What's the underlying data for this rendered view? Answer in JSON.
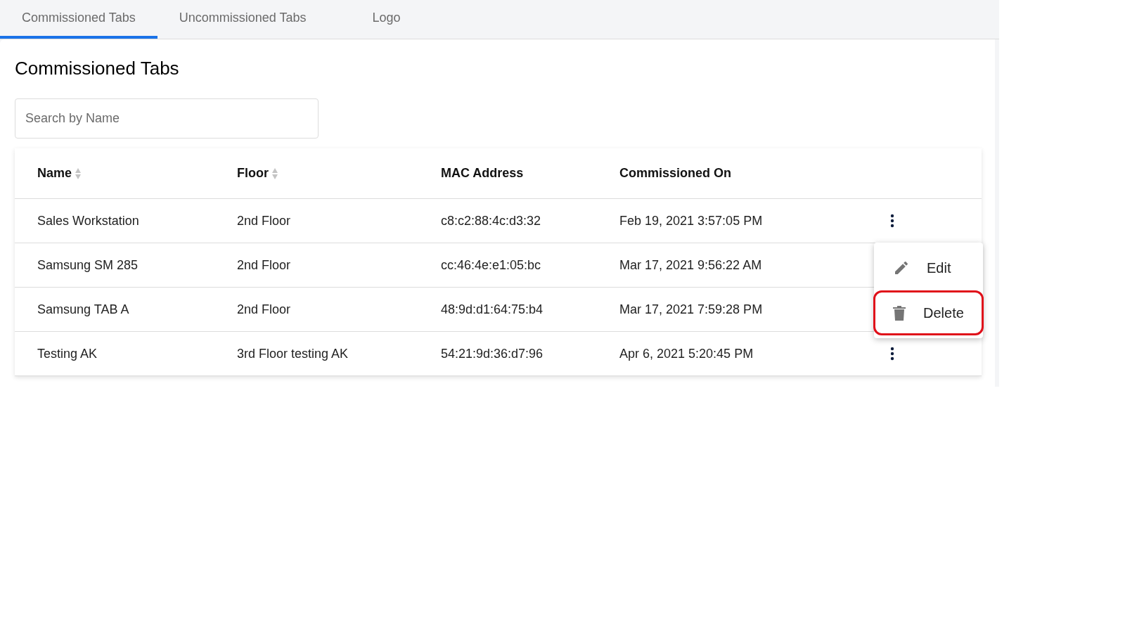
{
  "tabs": [
    {
      "label": "Commissioned Tabs",
      "selected": true
    },
    {
      "label": "Uncommissioned Tabs",
      "selected": false
    },
    {
      "label": "Logo",
      "selected": false
    }
  ],
  "heading": "Commissioned Tabs",
  "search": {
    "placeholder": "Search by Name"
  },
  "table": {
    "columns": [
      {
        "label": "Name",
        "sortable": true
      },
      {
        "label": "Floor",
        "sortable": true
      },
      {
        "label": "MAC Address",
        "sortable": false
      },
      {
        "label": "Commissioned On",
        "sortable": false
      }
    ],
    "rows": [
      {
        "cells": [
          "Sales Workstation",
          "2nd Floor",
          "c8:c2:88:4c:d3:32",
          "Feb 19, 2021 3:57:05 PM"
        ],
        "menu_button": true
      },
      {
        "cells": [
          "Samsung SM 285",
          "2nd Floor",
          "cc:46:4e:e1:05:bc",
          "Mar 17, 2021 9:56:22 AM"
        ],
        "menu_button": false
      },
      {
        "cells": [
          "Samsung TAB A",
          "2nd Floor",
          "48:9d:d1:64:75:b4",
          "Mar 17, 2021 7:59:28 PM"
        ],
        "menu_button": false
      },
      {
        "cells": [
          "Testing AK",
          "3rd Floor testing AK",
          "54:21:9d:36:d7:96",
          "Apr 6, 2021 5:20:45 PM"
        ],
        "menu_button": true
      }
    ]
  },
  "row_menu": {
    "items": [
      {
        "kind": "edit",
        "label": "Edit",
        "highlighted": false
      },
      {
        "kind": "delete",
        "label": "Delete",
        "highlighted": true
      }
    ]
  }
}
